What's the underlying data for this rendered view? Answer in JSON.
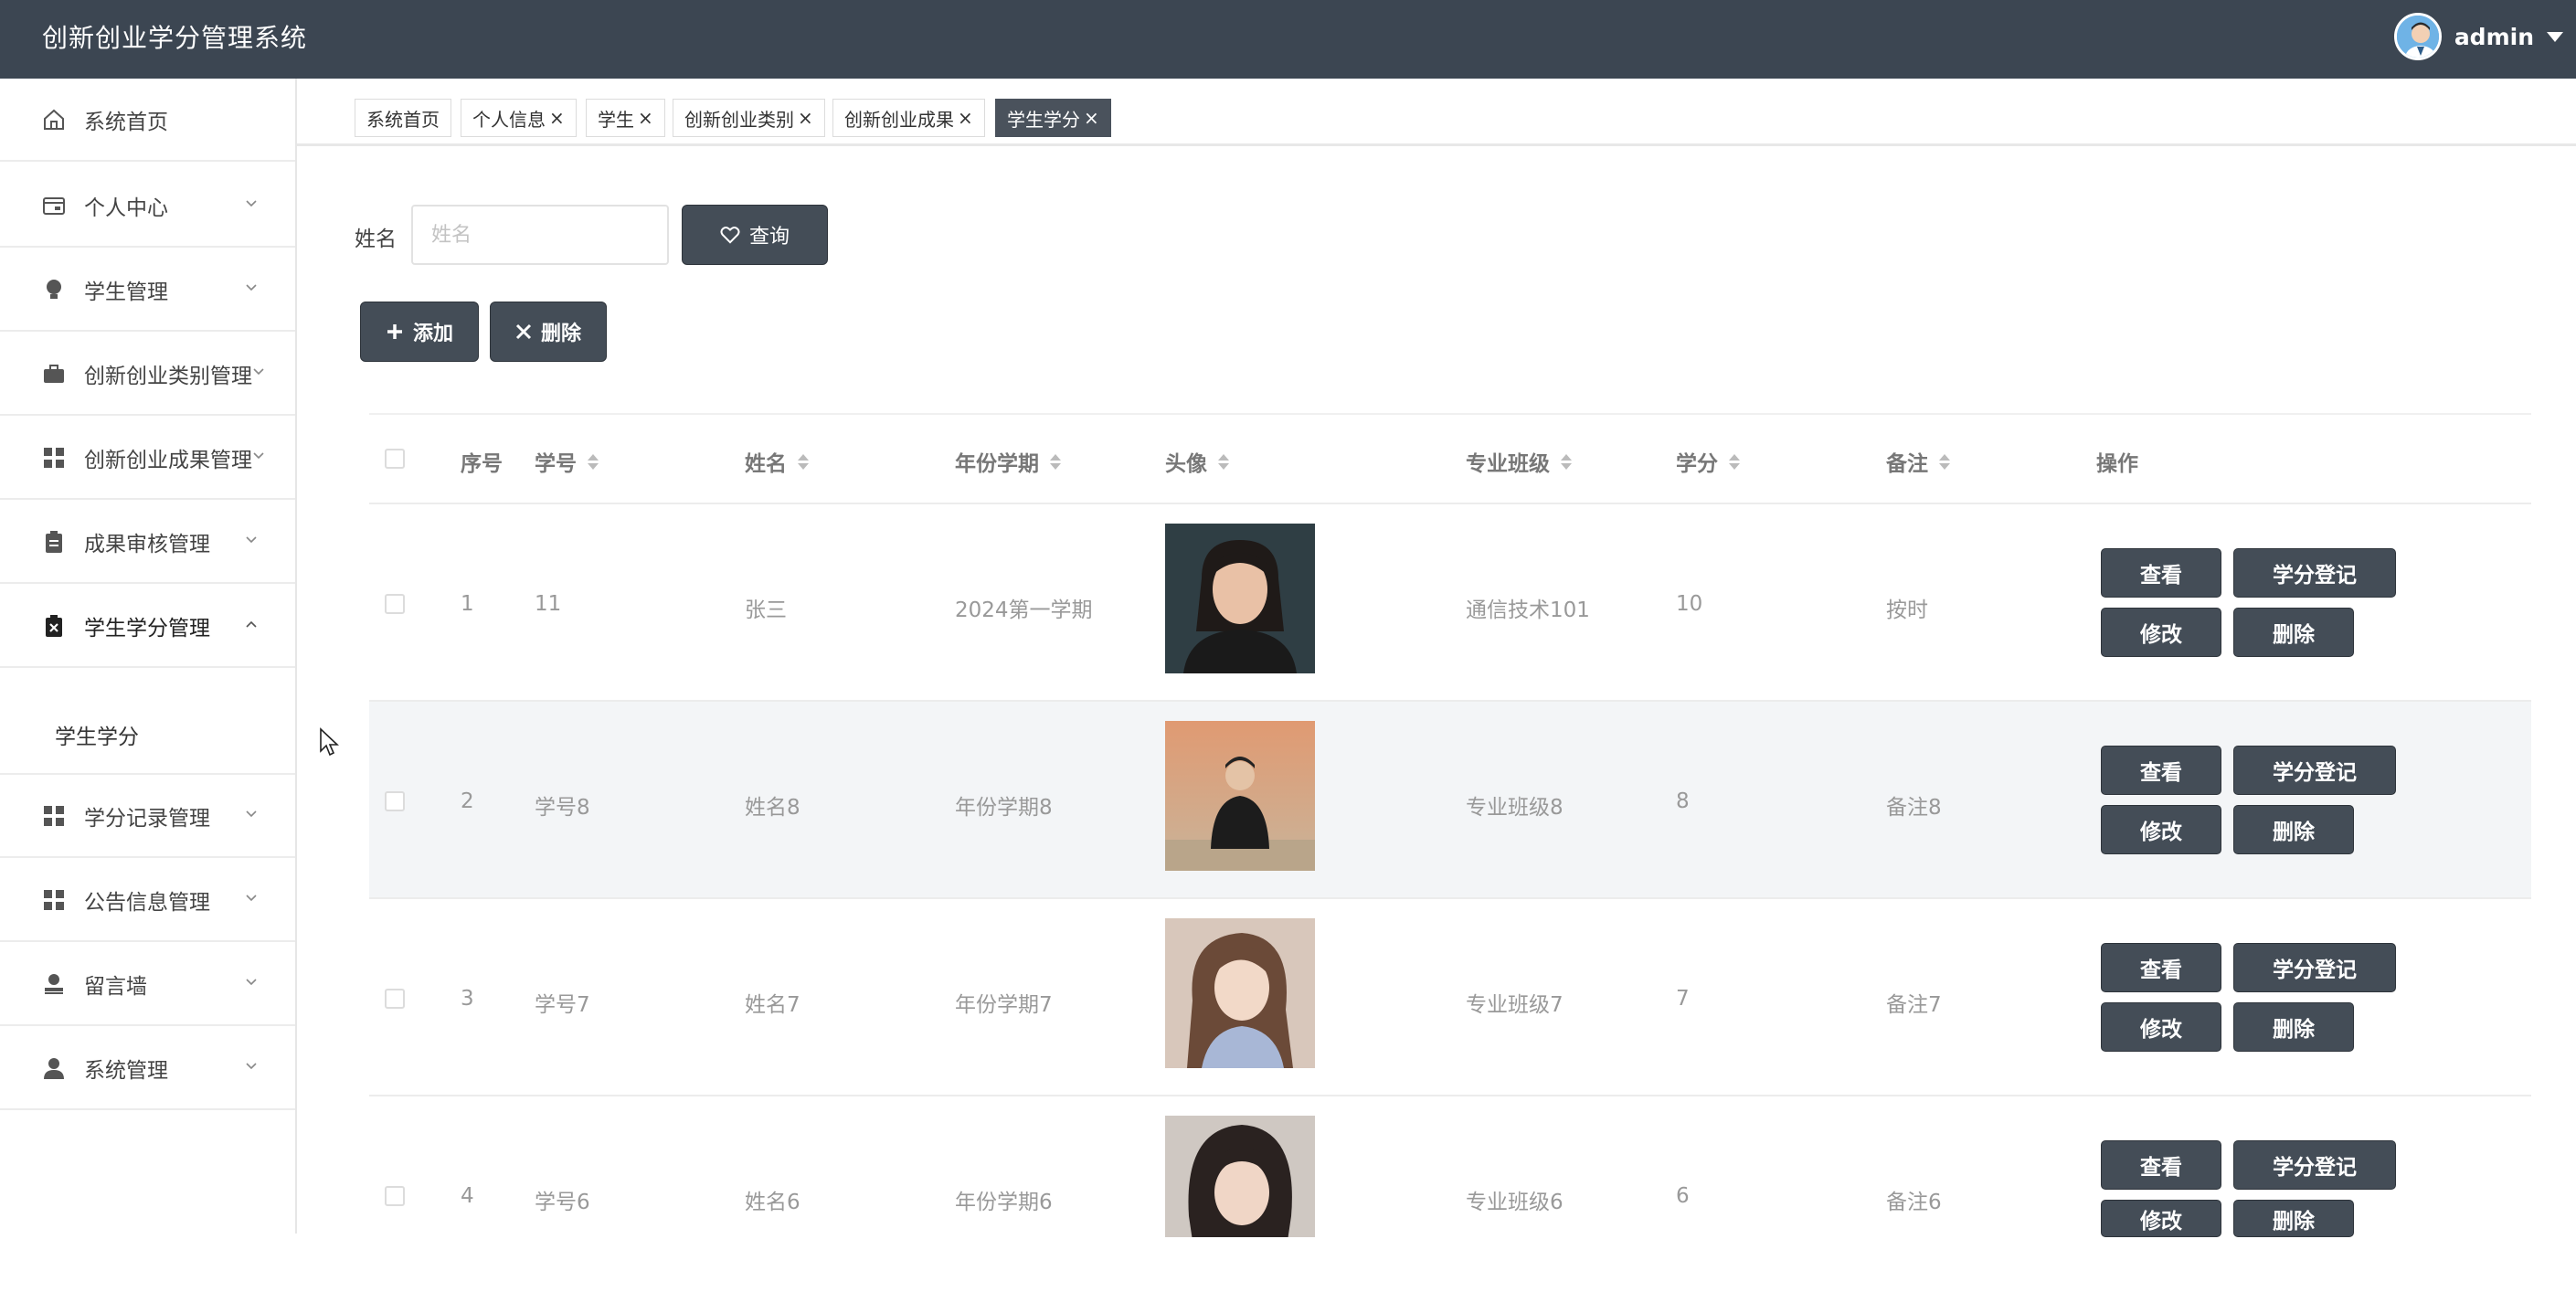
{
  "app": {
    "title": "创新创业学分管理系统",
    "username": "admin"
  },
  "sidebar": {
    "items": [
      {
        "label": "系统首页",
        "icon": "home-icon"
      },
      {
        "label": "个人中心",
        "icon": "card-icon"
      },
      {
        "label": "学生管理",
        "icon": "bulb-icon"
      },
      {
        "label": "创新创业类别管理",
        "icon": "briefcase-icon"
      },
      {
        "label": "创新创业成果管理",
        "icon": "grid-icon"
      },
      {
        "label": "成果审核管理",
        "icon": "clipboard-icon"
      },
      {
        "label": "学生学分管理",
        "icon": "clipboard-x-icon"
      },
      {
        "label": "学分记录管理",
        "icon": "grid-icon"
      },
      {
        "label": "公告信息管理",
        "icon": "grid-icon"
      },
      {
        "label": "留言墙",
        "icon": "user-icon"
      },
      {
        "label": "系统管理",
        "icon": "user-icon"
      }
    ],
    "subitem": "学生学分"
  },
  "tabs": [
    {
      "label": "系统首页",
      "closable": false
    },
    {
      "label": "个人信息",
      "closable": true
    },
    {
      "label": "学生",
      "closable": true
    },
    {
      "label": "创新创业类别",
      "closable": true
    },
    {
      "label": "创新创业成果",
      "closable": true
    },
    {
      "label": "学生学分",
      "closable": true,
      "active": true
    }
  ],
  "tab_close": "×",
  "search": {
    "label": "姓名",
    "placeholder": "姓名",
    "value": "",
    "button": "查询"
  },
  "toolbar": {
    "add": "添加",
    "delete": "删除"
  },
  "table": {
    "headers": {
      "index": "序号",
      "student_no": "学号",
      "name": "姓名",
      "term": "年份学期",
      "avatar": "头像",
      "class": "专业班级",
      "credit": "学分",
      "remark": "备注",
      "ops": "操作"
    },
    "rows": [
      {
        "index": "1",
        "student_no": "11",
        "name": "张三",
        "term": "2024第一学期",
        "class": "通信技术101",
        "credit": "10",
        "remark": "按时"
      },
      {
        "index": "2",
        "student_no": "学号8",
        "name": "姓名8",
        "term": "年份学期8",
        "class": "专业班级8",
        "credit": "8",
        "remark": "备注8"
      },
      {
        "index": "3",
        "student_no": "学号7",
        "name": "姓名7",
        "term": "年份学期7",
        "class": "专业班级7",
        "credit": "7",
        "remark": "备注7"
      },
      {
        "index": "4",
        "student_no": "学号6",
        "name": "姓名6",
        "term": "年份学期6",
        "class": "专业班级6",
        "credit": "6",
        "remark": "备注6"
      }
    ],
    "actions": {
      "view": "查看",
      "register": "学分登记",
      "edit": "修改",
      "delete": "删除"
    }
  },
  "colors": {
    "topbar": "#3c4652",
    "button": "#444d57",
    "active_tab": "#4a525c"
  }
}
